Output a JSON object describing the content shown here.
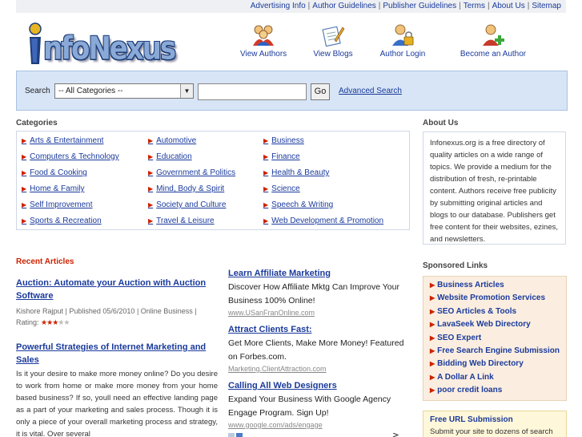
{
  "topnav": {
    "links": [
      "Advertising Info",
      "Author Guidelines",
      "Publisher Guidelines",
      "Terms",
      "About Us",
      "Sitemap"
    ]
  },
  "logo": {
    "text": "nfoNexus"
  },
  "quicklinks": [
    {
      "label": "View Authors",
      "icon": "authors-icon"
    },
    {
      "label": "View Blogs",
      "icon": "blogs-icon"
    },
    {
      "label": "Author Login",
      "icon": "author-login-icon"
    },
    {
      "label": "Become an Author",
      "icon": "become-author-icon"
    }
  ],
  "search": {
    "label": "Search",
    "category_selected": "-- All Categories --",
    "query_value": "",
    "go_label": "Go",
    "advanced_label": "Advanced Search"
  },
  "categories": {
    "heading": "Categories",
    "col1": [
      "Arts & Entertainment",
      "Computers & Technology",
      "Food & Cooking",
      "Home & Family",
      "Self Improvement",
      "Sports & Recreation"
    ],
    "col2": [
      "Automotive",
      "Education",
      "Government & Politics",
      "Mind, Body & Spirit",
      "Society and Culture",
      "Travel & Leisure"
    ],
    "col3": [
      "Business",
      "Finance",
      "Health & Beauty",
      "Science",
      "Speech & Writing",
      "Web Development & Promotion"
    ]
  },
  "about": {
    "heading": "About Us",
    "text": "Infonexus.org is a free directory of quality articles on a wide range of topics.  We provide a medium for the distribution of fresh, re-printable content. Authors receive free publicity by submitting original articles and blogs to our database. Publishers get free content for their websites, ezines, and newsletters."
  },
  "recent": {
    "heading": "Recent Articles",
    "articles": [
      {
        "title": "Auction: Automate your Auction with Auction Software",
        "meta": "Kishore Rajput | Published 05/6/2010 | Online Business | Rating:",
        "rating": 3,
        "rating_max": 5
      },
      {
        "title": "Powerful Strategies of Internet Marketing and Sales",
        "body": "Is it your desire to make more money online? Do you desire to work from home or make more money from your home based business? If so, youll need an effective landing page as a part of your marketing and sales process. Though it is only a piece of your overall marketing process and strategy, it is vital. Over several"
      }
    ]
  },
  "ads": [
    {
      "title": "Learn Affiliate Marketing",
      "desc": "Discover How Affiliate Mktg Can Improve Your Business 100% Online!",
      "url": "www.USanFranOnline.com"
    },
    {
      "title": "Attract Clients Fast:",
      "desc": "Get More Clients, Make More Money! Featured on Forbes.com.",
      "url": "Marketing.ClientAttraction.com"
    },
    {
      "title": "Calling All Web Designers",
      "desc": "Expand Your Business With Google Agency Engage Program. Sign Up!",
      "url": "www.google.com/ads/engage"
    }
  ],
  "sponsored": {
    "heading": "Sponsored Links",
    "items": [
      "Business Articles",
      "Website Promotion Services",
      "SEO Articles & Tools",
      "LavaSeek Web Directory",
      "SEO Expert",
      "Free Search Engine Submission",
      "Bidding Web Directory",
      "A Dollar A Link",
      "poor credit loans"
    ]
  },
  "free_url": {
    "title": "Free URL Submission",
    "desc": "Submit your site to dozens of search"
  },
  "colors": {
    "accent_red": "#cc2200",
    "link_blue": "#1a3a9c",
    "search_bg": "#d7e5f6"
  }
}
